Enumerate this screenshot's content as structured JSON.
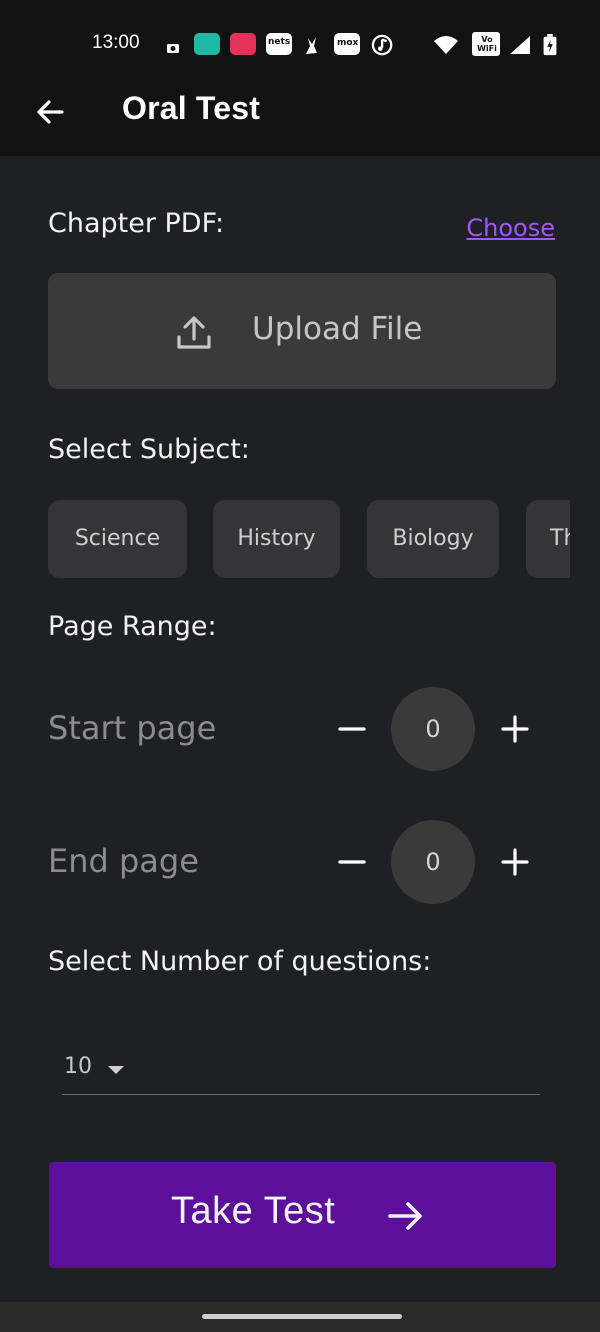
{
  "status_bar": {
    "time": "13:00",
    "app_icons": [
      "camera-icon",
      "teal-app-icon",
      "red-app-icon",
      "news-app-icon",
      "rabbit-app-icon",
      "mox-app-icon",
      "music-app-icon"
    ],
    "news_badge": "nets",
    "mox_badge": "mox",
    "vowifi": "Vo WiFi"
  },
  "app_bar": {
    "title": "Oral Test"
  },
  "chapter": {
    "label": "Chapter PDF:",
    "choose": "Choose",
    "upload_label": "Upload File"
  },
  "subject": {
    "label": "Select Subject:",
    "chips": [
      "Science",
      "History",
      "Biology",
      "Th"
    ]
  },
  "page_range": {
    "label": "Page Range:",
    "start_label": "Start page",
    "start_value": "0",
    "end_label": "End page",
    "end_value": "0"
  },
  "questions": {
    "label": "Select Number of questions:",
    "selected": "10"
  },
  "take_test": {
    "label": "Take Test"
  },
  "colors": {
    "accent": "#5c0f9b",
    "link": "#a356ff",
    "background": "#1f2023"
  }
}
